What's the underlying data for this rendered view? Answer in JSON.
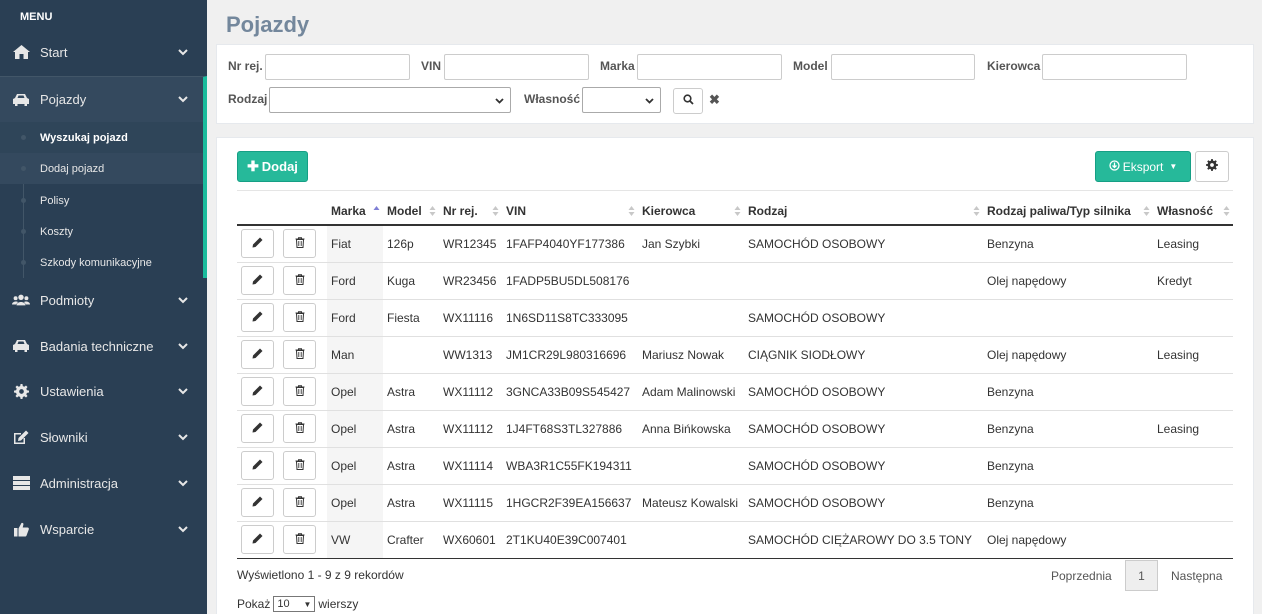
{
  "sidebar": {
    "menu_title": "MENU",
    "items": [
      {
        "label": "Start",
        "icon": "home-icon"
      },
      {
        "label": "Pojazdy",
        "icon": "car-icon"
      },
      {
        "label": "Podmioty",
        "icon": "users-icon"
      },
      {
        "label": "Badania techniczne",
        "icon": "car-icon"
      },
      {
        "label": "Ustawienia",
        "icon": "gear-icon"
      },
      {
        "label": "Słowniki",
        "icon": "edit-icon"
      },
      {
        "label": "Administracja",
        "icon": "server-icon"
      },
      {
        "label": "Wsparcie",
        "icon": "thumbs-up-icon"
      }
    ],
    "subitems": [
      {
        "label": "Wyszukaj pojazd"
      },
      {
        "label": "Dodaj pojazd"
      },
      {
        "label": "Polisy"
      },
      {
        "label": "Koszty"
      },
      {
        "label": "Szkody komunikacyjne"
      }
    ]
  },
  "page": {
    "title": "Pojazdy"
  },
  "filters": {
    "nr_rej": {
      "label": "Nr rej.",
      "value": ""
    },
    "vin": {
      "label": "VIN",
      "value": ""
    },
    "marka": {
      "label": "Marka",
      "value": ""
    },
    "model": {
      "label": "Model",
      "value": ""
    },
    "kierowca": {
      "label": "Kierowca",
      "value": ""
    },
    "rodzaj": {
      "label": "Rodzaj",
      "value": ""
    },
    "wlasnosc": {
      "label": "Własność",
      "value": ""
    }
  },
  "toolbar": {
    "add_label": "Dodaj",
    "export_label": "Eksport"
  },
  "table": {
    "columns": [
      "Marka",
      "Model",
      "Nr rej.",
      "VIN",
      "Kierowca",
      "Rodzaj",
      "Rodzaj paliwa/Typ silnika",
      "Własność"
    ],
    "rows": [
      [
        "Fiat",
        "126p",
        "WR12345",
        "1FAFP4040YF177386",
        "Jan Szybki",
        "SAMOCHÓD OSOBOWY",
        "Benzyna",
        "Leasing"
      ],
      [
        "Ford",
        "Kuga",
        "WR23456",
        "1FADP5BU5DL508176",
        "",
        "",
        "Olej napędowy",
        "Kredyt"
      ],
      [
        "Ford",
        "Fiesta",
        "WX11116",
        "1N6SD11S8TC333095",
        "",
        "SAMOCHÓD OSOBOWY",
        "",
        ""
      ],
      [
        "Man",
        "",
        "WW1313",
        "JM1CR29L980316696",
        "Mariusz Nowak",
        "CIĄGNIK SIODŁOWY",
        "Olej napędowy",
        "Leasing"
      ],
      [
        "Opel",
        "Astra",
        "WX11112",
        "3GNCA33B09S545427",
        "Adam Malinowski",
        "SAMOCHÓD OSOBOWY",
        "Benzyna",
        ""
      ],
      [
        "Opel",
        "Astra",
        "WX11112",
        "1J4FT68S3TL327886",
        "Anna Bińkowska",
        "SAMOCHÓD OSOBOWY",
        "Benzyna",
        "Leasing"
      ],
      [
        "Opel",
        "Astra",
        "WX11114",
        "WBA3R1C55FK194311",
        "",
        "SAMOCHÓD OSOBOWY",
        "Benzyna",
        ""
      ],
      [
        "Opel",
        "Astra",
        "WX11115",
        "1HGCR2F39EA156637",
        "Mateusz Kowalski",
        "SAMOCHÓD OSOBOWY",
        "Benzyna",
        ""
      ],
      [
        "VW",
        "Crafter",
        "WX60601",
        "2T1KU40E39C007401",
        "",
        "SAMOCHÓD CIĘŻAROWY DO 3.5 TONY",
        "Olej napędowy",
        ""
      ]
    ]
  },
  "footer": {
    "info": "Wyświetlono 1 - 9 z 9 rekordów",
    "prev": "Poprzednia",
    "page": "1",
    "next": "Następna",
    "show_prefix": "Pokaż",
    "show_value": "10",
    "show_suffix": "wierszy"
  },
  "colors": {
    "sidebar": "#2a3f54",
    "accent": "#26b99a"
  }
}
